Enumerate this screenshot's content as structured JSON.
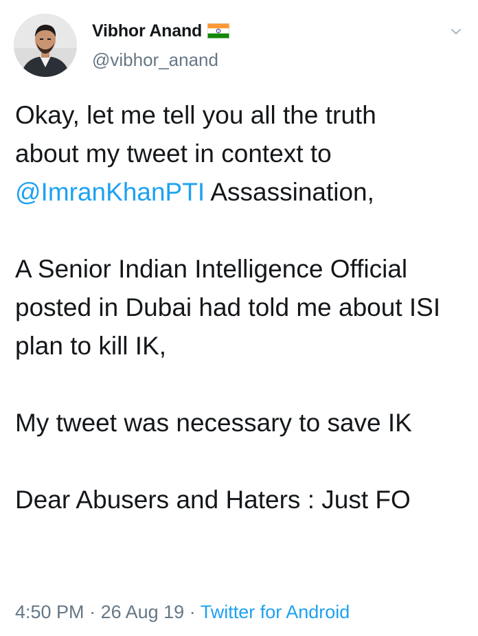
{
  "author": {
    "display_name": "Vibhor Anand",
    "handle": "@vibhor_anand",
    "flag_icon": "india-flag-icon",
    "avatar_icon": "avatar-photo"
  },
  "actions": {
    "menu_icon": "chevron-down-icon"
  },
  "tweet": {
    "p1_line1": "Okay, let me tell you all the truth",
    "p1_line2": "about my tweet in context to",
    "mention": "@ImranKhanPTI",
    "p1_after_mention": " Assassination,",
    "p2": "A Senior Indian Intelligence Official posted in Dubai had told me about ISI plan to kill IK,",
    "p3": "My tweet was necessary to save IK",
    "p4": "Dear Abusers and Haters : Just FO"
  },
  "meta": {
    "time": "4:50 PM",
    "separator": " · ",
    "date": "26 Aug 19",
    "source": "Twitter for Android"
  },
  "colors": {
    "link": "#1da1f2",
    "secondary_text": "#657786",
    "primary_text": "#14171a",
    "flag_saffron": "#ff9933",
    "flag_green": "#138808",
    "flag_chakra": "#000080"
  }
}
